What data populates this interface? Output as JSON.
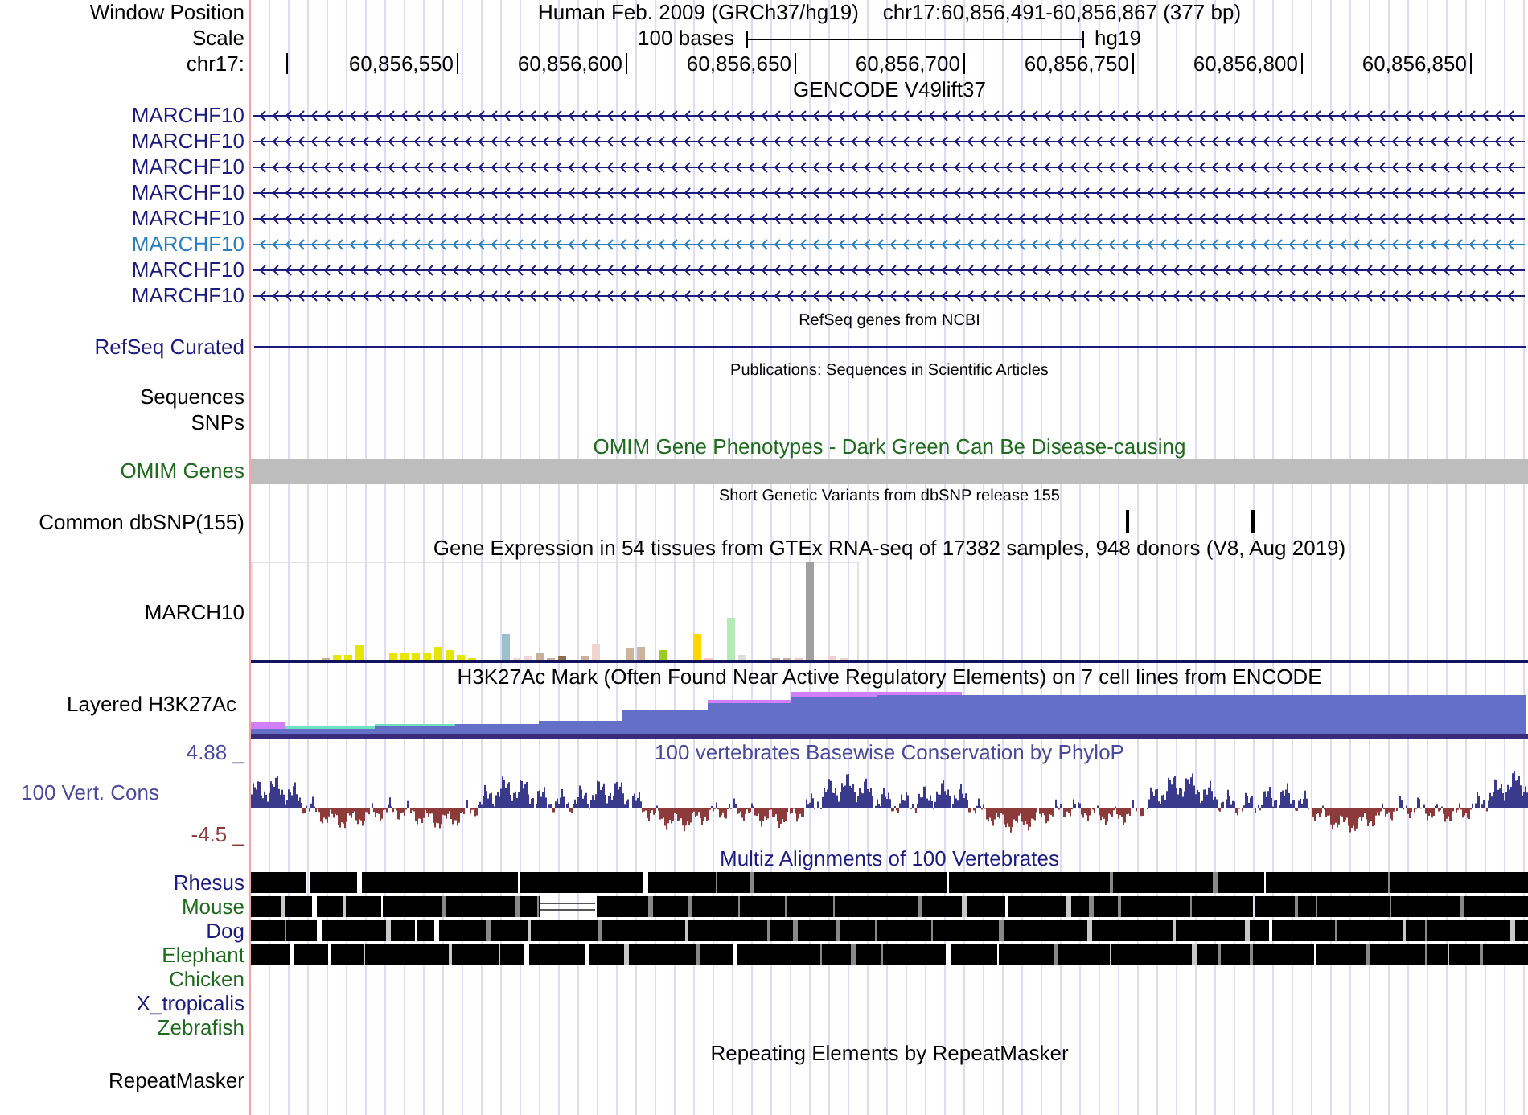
{
  "header": {
    "position_label": "Window Position",
    "assembly": "Human Feb. 2009 (GRCh37/hg19)",
    "position": "chr17:60,856,491-60,856,867 (377 bp)",
    "scale_label": "Scale",
    "scale_text": "100 bases",
    "scale_db": "hg19",
    "chrom_label": "chr17:",
    "ticks": [
      "60,856,550",
      "60,856,600",
      "60,856,650",
      "60,856,700",
      "60,856,750",
      "60,856,800",
      "60,856,850"
    ]
  },
  "tracks": [
    {
      "kind": "gencode",
      "title": "GENCODE V49lift37",
      "genes": [
        {
          "label": "MARCHF10",
          "selected": false
        },
        {
          "label": "MARCHF10",
          "selected": false
        },
        {
          "label": "MARCHF10",
          "selected": false
        },
        {
          "label": "MARCHF10",
          "selected": false
        },
        {
          "label": "MARCHF10",
          "selected": false
        },
        {
          "label": "MARCHF10",
          "selected": true
        },
        {
          "label": "MARCHF10",
          "selected": false
        },
        {
          "label": "MARCHF10",
          "selected": false
        }
      ]
    },
    {
      "kind": "refseq",
      "title": "RefSeq genes from NCBI",
      "label": "RefSeq Curated"
    },
    {
      "kind": "publications",
      "title": "Publications: Sequences in Scientific Articles",
      "labels": [
        "Sequences",
        "SNPs"
      ]
    },
    {
      "kind": "omim",
      "title": "OMIM Gene Phenotypes - Dark Green Can Be Disease-causing",
      "label": "OMIM Genes"
    },
    {
      "kind": "dbsnp",
      "title": "Short Genetic Variants from dbSNP release 155",
      "label": "Common dbSNP(155)"
    },
    {
      "kind": "gtex",
      "title": "Gene Expression in 54 tissues from GTEx RNA-seq of 17382 samples, 948 donors (V8, Aug 2019)",
      "label": "MARCH10"
    },
    {
      "kind": "h3k27ac",
      "title": "H3K27Ac Mark (Often Found Near Active Regulatory Elements) on 7 cell lines from ENCODE",
      "label": "Layered H3K27Ac"
    },
    {
      "kind": "conservation",
      "title": "100 vertebrates Basewise Conservation by PhyloP",
      "label": "100 Vert. Cons",
      "max": "4.88 _",
      "min": "-4.5 _"
    },
    {
      "kind": "multiz",
      "title": "Multiz Alignments of 100 Vertebrates",
      "species": [
        {
          "name": "Rhesus",
          "color": "#1c1c80",
          "aligned": true
        },
        {
          "name": "Mouse",
          "color": "#1e6b1e",
          "aligned": true
        },
        {
          "name": "Dog",
          "color": "#1c1c80",
          "aligned": true
        },
        {
          "name": "Elephant",
          "color": "#1e6b1e",
          "aligned": true
        },
        {
          "name": "Chicken",
          "color": "#1e6b1e",
          "aligned": false
        },
        {
          "name": "X_tropicalis",
          "color": "#1c1c80",
          "aligned": false
        },
        {
          "name": "Zebrafish",
          "color": "#1e6b1e",
          "aligned": false
        }
      ]
    },
    {
      "kind": "repeatmasker",
      "title": "Repeating Elements by RepeatMasker",
      "label": "RepeatMasker"
    }
  ]
}
